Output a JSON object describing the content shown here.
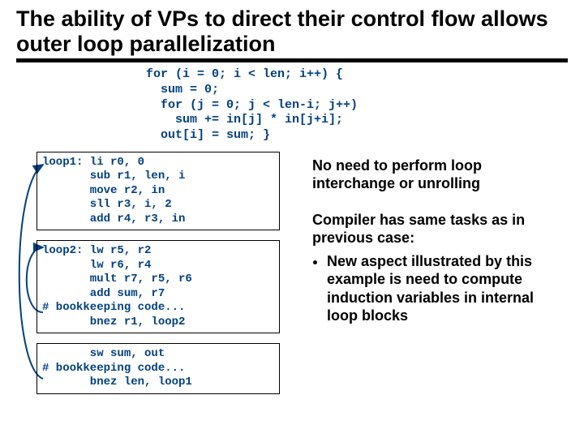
{
  "title": "The ability of VPs to direct their control flow allows outer loop parallelization",
  "c_code": "for (i = 0; i < len; i++) {\n  sum = 0;\n  for (j = 0; j < len-i; j++)\n    sum += in[j] * in[j+i];\n  out[i] = sum; }",
  "asm1": "loop1: li r0, 0\n       sub r1, len, i\n       move r2, in\n       sll r3, i, 2\n       add r4, r3, in",
  "asm2": "loop2: lw r5, r2\n       lw r6, r4\n       mult r7, r5, r6\n       add sum, r7\n# bookkeeping code...\n       bnez r1, loop2",
  "asm3": "       sw sum, out\n# bookkeeping code...\n       bnez len, loop1",
  "note1": "No need to perform loop interchange or unrolling",
  "note2_intro": "Compiler has same tasks as in previous case:",
  "note2_bullet": "New aspect illustrated by this example is need to compute induction variables in internal loop blocks"
}
